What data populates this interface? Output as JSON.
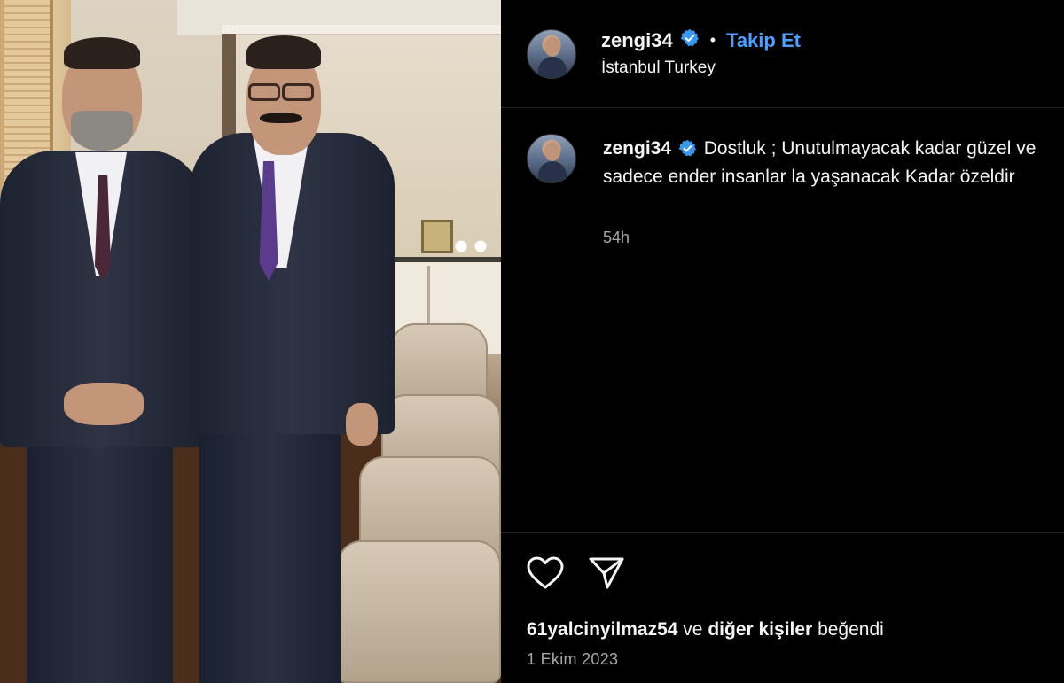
{
  "post": {
    "author": "zengi34",
    "follow_label": "Takip Et",
    "separator": "•",
    "location": "İstanbul Turkey",
    "photo_label": "Photo of two men in suits standing in a meeting room"
  },
  "caption": {
    "author": "zengi34",
    "text": "Dostluk ; Unutulmayacak kadar güzel ve sadece ender insanlar la yaşanacak Kadar özeldir",
    "time_ago": "54h"
  },
  "likes": {
    "user": "61yalcinyilmaz54",
    "connector": "ve",
    "others": "diğer kişiler",
    "suffix": "beğendi"
  },
  "date": "1 Ekim 2023",
  "icons": {
    "verified": "verified-badge-icon",
    "like": "heart-icon",
    "share": "paper-plane-icon"
  },
  "colors": {
    "background": "#000000",
    "text": "#f5f5f5",
    "secondary_text": "#a8a8a8",
    "accent": "#4ca0ff",
    "verified": "#3897f0"
  }
}
